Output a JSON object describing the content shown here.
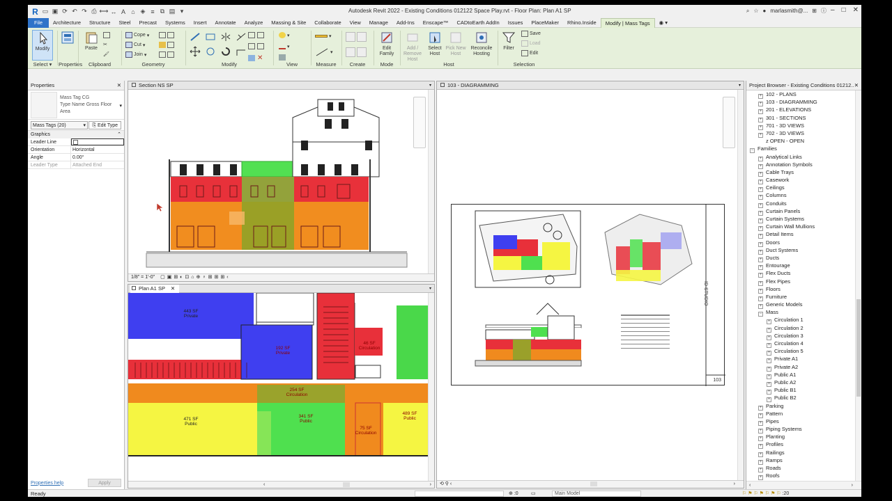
{
  "window_title": "Autodesk Revit 2022 - Existing Conditions 012122 Space Play.rvt - Floor Plan: Plan A1 SP",
  "user": "marlasmith@...",
  "tabs": [
    "File",
    "Architecture",
    "Structure",
    "Steel",
    "Precast",
    "Systems",
    "Insert",
    "Annotate",
    "Analyze",
    "Massing & Site",
    "Collaborate",
    "View",
    "Manage",
    "Add-Ins",
    "Enscape™",
    "CADtoEarth AddIn",
    "Issues",
    "PlaceMaker",
    "Rhino.Inside",
    "Modify | Mass Tags"
  ],
  "active_tab": "Modify | Mass Tags",
  "ribbon": {
    "select": {
      "button": "Modify",
      "label": "Select"
    },
    "properties": {
      "label": "Properties"
    },
    "clipboard": {
      "paste": "Paste",
      "cope": "Cope",
      "cut": "Cut",
      "join": "Join",
      "label": "Clipboard"
    },
    "geometry": {
      "label": "Geometry"
    },
    "modify": {
      "label": "Modify"
    },
    "view": {
      "label": "View"
    },
    "measure": {
      "label": "Measure"
    },
    "create": {
      "label": "Create"
    },
    "mode": {
      "edit_family": "Edit Family",
      "label": "Mode"
    },
    "host": {
      "add_remove": "Add / Remove Host",
      "select_host": "Select Host",
      "pick_new": "Pick New Host",
      "reconcile": "Reconcile Hosting",
      "label": "Host"
    },
    "selection": {
      "filter": "Filter",
      "save": "Save",
      "load": "Load",
      "edit": "Edit",
      "label": "Selection"
    }
  },
  "properties": {
    "title": "Properties",
    "type_line1": "Mass Tag CG",
    "type_line2": "Type Name Gross Floor",
    "type_line3": "Area",
    "filter": "Mass Tags (20)",
    "edit_type": "Edit Type",
    "group": "Graphics",
    "rows": [
      {
        "k": "Leader Line",
        "v": ""
      },
      {
        "k": "Orientation",
        "v": "Horizontal"
      },
      {
        "k": "Angle",
        "v": "0.00°"
      },
      {
        "k": "Leader Type",
        "v": "Attached End"
      }
    ],
    "help": "Properties help",
    "apply": "Apply"
  },
  "views": {
    "section": {
      "title": "Section NS SP",
      "scale": "1/8\" = 1'-0\""
    },
    "plan": {
      "title": "Plan A1 SP"
    },
    "sheet": {
      "title": "103 - DIAGRAMMING",
      "sheet_no": "103",
      "studio": "ID STUDIO"
    }
  },
  "plan_labels": [
    {
      "area": "443 SF",
      "name": "Private"
    },
    {
      "area": "192 SF",
      "name": "Private"
    },
    {
      "area": "46 SF",
      "name": "Circulation"
    },
    {
      "area": "254 SF",
      "name": "Circulation"
    },
    {
      "area": "471 SF",
      "name": "Public"
    },
    {
      "area": "341 SF",
      "name": "Public"
    },
    {
      "area": "75 SF",
      "name": "Circulation"
    },
    {
      "area": "489 SF",
      "name": "Public"
    }
  ],
  "project_browser": {
    "title": "Project Browser - Existing Conditions 01212...",
    "items": [
      {
        "label": "102 - PLANS",
        "level": 1,
        "ex": "+"
      },
      {
        "label": "103 - DIAGRAMMING",
        "level": 1,
        "ex": "+"
      },
      {
        "label": "201 - ELEVATIONS",
        "level": 1,
        "ex": "+"
      },
      {
        "label": "301 - SECTIONS",
        "level": 1,
        "ex": "+"
      },
      {
        "label": "701 - 3D VIEWS",
        "level": 1,
        "ex": "+"
      },
      {
        "label": "702 - 3D VIEWS",
        "level": 1,
        "ex": "+"
      },
      {
        "label": "z OPEN - OPEN",
        "level": 1,
        "ex": ""
      },
      {
        "label": "Families",
        "level": 0,
        "ex": "−"
      },
      {
        "label": "Analytical Links",
        "level": 1,
        "ex": "+"
      },
      {
        "label": "Annotation Symbols",
        "level": 1,
        "ex": "+"
      },
      {
        "label": "Cable Trays",
        "level": 1,
        "ex": "+"
      },
      {
        "label": "Casework",
        "level": 1,
        "ex": "+"
      },
      {
        "label": "Ceilings",
        "level": 1,
        "ex": "+"
      },
      {
        "label": "Columns",
        "level": 1,
        "ex": "+"
      },
      {
        "label": "Conduits",
        "level": 1,
        "ex": "+"
      },
      {
        "label": "Curtain Panels",
        "level": 1,
        "ex": "+"
      },
      {
        "label": "Curtain Systems",
        "level": 1,
        "ex": "+"
      },
      {
        "label": "Curtain Wall Mullions",
        "level": 1,
        "ex": "+"
      },
      {
        "label": "Detail Items",
        "level": 1,
        "ex": "+"
      },
      {
        "label": "Doors",
        "level": 1,
        "ex": "+"
      },
      {
        "label": "Duct Systems",
        "level": 1,
        "ex": "+"
      },
      {
        "label": "Ducts",
        "level": 1,
        "ex": "+"
      },
      {
        "label": "Entourage",
        "level": 1,
        "ex": "+"
      },
      {
        "label": "Flex Ducts",
        "level": 1,
        "ex": "+"
      },
      {
        "label": "Flex Pipes",
        "level": 1,
        "ex": "+"
      },
      {
        "label": "Floors",
        "level": 1,
        "ex": "+"
      },
      {
        "label": "Furniture",
        "level": 1,
        "ex": "+"
      },
      {
        "label": "Generic Models",
        "level": 1,
        "ex": "+"
      },
      {
        "label": "Mass",
        "level": 1,
        "ex": "−"
      },
      {
        "label": "Circulation 1",
        "level": 2,
        "ex": "+"
      },
      {
        "label": "Circulation 2",
        "level": 2,
        "ex": "+"
      },
      {
        "label": "Circulation 3",
        "level": 2,
        "ex": "+"
      },
      {
        "label": "Circulation 4",
        "level": 2,
        "ex": "+"
      },
      {
        "label": "Circulation 5",
        "level": 2,
        "ex": "+"
      },
      {
        "label": "Private A1",
        "level": 2,
        "ex": "+"
      },
      {
        "label": "Private A2",
        "level": 2,
        "ex": "+"
      },
      {
        "label": "Public A1",
        "level": 2,
        "ex": "+"
      },
      {
        "label": "Public A2",
        "level": 2,
        "ex": "+"
      },
      {
        "label": "Public B1",
        "level": 2,
        "ex": "+"
      },
      {
        "label": "Public B2",
        "level": 2,
        "ex": "+"
      },
      {
        "label": "Parking",
        "level": 1,
        "ex": "+"
      },
      {
        "label": "Pattern",
        "level": 1,
        "ex": "+"
      },
      {
        "label": "Pipes",
        "level": 1,
        "ex": "+"
      },
      {
        "label": "Piping Systems",
        "level": 1,
        "ex": "+"
      },
      {
        "label": "Planting",
        "level": 1,
        "ex": "+"
      },
      {
        "label": "Profiles",
        "level": 1,
        "ex": "+"
      },
      {
        "label": "Railings",
        "level": 1,
        "ex": "+"
      },
      {
        "label": "Ramps",
        "level": 1,
        "ex": "+"
      },
      {
        "label": "Roads",
        "level": 1,
        "ex": "+"
      },
      {
        "label": "Roofs",
        "level": 1,
        "ex": "+"
      }
    ]
  },
  "status": {
    "text": "Ready",
    "workset": ":0",
    "model": "Main Model",
    "count": ":20"
  },
  "colors": {
    "private": "#3b3bf0",
    "circulation": "#e8303a",
    "public_yellow": "#f5f542",
    "public_green": "#4fe04f",
    "orange": "#f08a1e",
    "ribbon": "#e6f0db",
    "accent": "#2f73c9"
  }
}
